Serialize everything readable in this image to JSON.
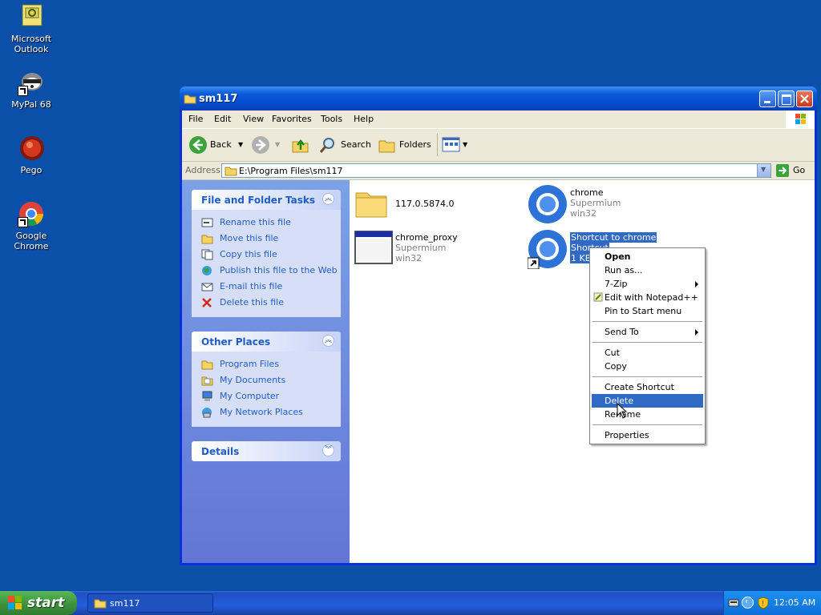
{
  "desktop": {
    "icons": [
      {
        "label": "Microsoft Outlook",
        "icon": "outlook-icon"
      },
      {
        "label": "MyPal 68",
        "icon": "mypal-icon"
      },
      {
        "label": "Pego",
        "icon": "pego-icon"
      },
      {
        "label": "Google Chrome",
        "icon": "chrome-icon"
      }
    ]
  },
  "window": {
    "title": "sm117",
    "menu": [
      "File",
      "Edit",
      "View",
      "Favorites",
      "Tools",
      "Help"
    ],
    "toolbar": {
      "back": "Back",
      "search": "Search",
      "folders": "Folders"
    },
    "address": {
      "label": "Address",
      "value": "E:\\Program Files\\sm117",
      "go": "Go"
    }
  },
  "left_pane": {
    "file_tasks": {
      "title": "File and Folder Tasks",
      "items": [
        "Rename this file",
        "Move this file",
        "Copy this file",
        "Publish this file to the Web",
        "E-mail this file",
        "Delete this file"
      ]
    },
    "other_places": {
      "title": "Other Places",
      "items": [
        "Program Files",
        "My Documents",
        "My Computer",
        "My Network Places"
      ]
    },
    "details": {
      "title": "Details"
    }
  },
  "files": [
    {
      "name": "117.0.5874.0",
      "sub1": "",
      "sub2": ""
    },
    {
      "name": "chrome",
      "sub1": "Supermium",
      "sub2": "win32"
    },
    {
      "name": "chrome_proxy",
      "sub1": "Supermium",
      "sub2": "win32"
    },
    {
      "name": "Shortcut to chrome",
      "sub1": "Shortcut",
      "sub2": "1 KB"
    }
  ],
  "context_menu": {
    "items": [
      "Open",
      "Run as...",
      "7-Zip",
      "Edit with Notepad++",
      "Pin to Start menu",
      "Send To",
      "Cut",
      "Copy",
      "Create Shortcut",
      "Delete",
      "Rename",
      "Properties"
    ],
    "highlighted": "Delete"
  },
  "taskbar": {
    "start": "start",
    "task_button": "sm117",
    "clock": "12:05 AM"
  },
  "colors": {
    "accent": "#316ac5",
    "desktop": "#0a4fa8",
    "link": "#215dc6"
  }
}
